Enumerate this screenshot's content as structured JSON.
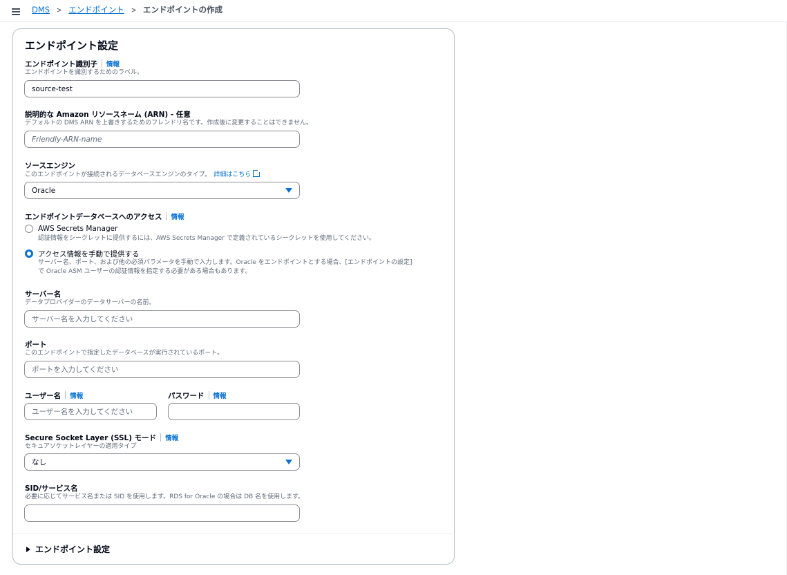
{
  "breadcrumb": {
    "items": [
      "DMS",
      "エンドポイント"
    ],
    "current": "エンドポイントの作成"
  },
  "card": {
    "title": "エンドポイント設定",
    "info_label": "情報",
    "identifier": {
      "label": "エンドポイント識別子",
      "desc": "エンドポイントを識別するためのラベル。",
      "value": "source-test"
    },
    "arn": {
      "label": "説明的な Amazon リソースネーム (ARN) - 任意",
      "desc": "デフォルトの DMS ARN を上書きするためのフレンドリ名です。作成後に変更することはできません。",
      "placeholder": "Friendly-ARN-name"
    },
    "engine": {
      "label": "ソースエンジン",
      "desc": "このエンドポイントが接続されるデータベースエンジンのタイプ。",
      "link": "詳細はこちら",
      "value": "Oracle"
    },
    "access": {
      "label": "エンドポイントデータベースへのアクセス",
      "options": [
        {
          "label": "AWS Secrets Manager",
          "desc": [
            "認証情報をシークレットに提供するには、AWS Secrets Manager で定義されているシークレットを使用してください。"
          ],
          "selected": false
        },
        {
          "label": "アクセス情報を手動で提供する",
          "desc": [
            "サーバー名、ポート、および他の必須パラメータを手動で入力します。Oracle をエンドポイントとする場合、[エンドポイントの設定]",
            "で Oracle ASM ユーザーの認証情報を指定する必要がある場合もあります。"
          ],
          "selected": true
        }
      ]
    },
    "server": {
      "label": "サーバー名",
      "desc": "データプロバイダーのデータサーバーの名前。",
      "placeholder": "サーバー名を入力してください"
    },
    "port": {
      "label": "ポート",
      "desc": "このエンドポイントで指定したデータベースが実行されているポート。",
      "placeholder": "ポートを入力してください"
    },
    "username": {
      "label": "ユーザー名",
      "placeholder": "ユーザー名を入力してください"
    },
    "password": {
      "label": "パスワード"
    },
    "ssl": {
      "label": "Secure Socket Layer (SSL) モード",
      "desc": "セキュアソケットレイヤーの適用タイプ",
      "value": "なし"
    },
    "sid": {
      "label": "SID/サービス名",
      "desc": "必要に応じてサービス名または SID を使用します。RDS for Oracle の場合は DB 名を使用します。"
    },
    "expander_label": "エンドポイント設定"
  },
  "colors": {
    "accent": "#0972d3",
    "border": "#8c8c94",
    "text": "#000716",
    "muted": "#5f6b7a"
  }
}
